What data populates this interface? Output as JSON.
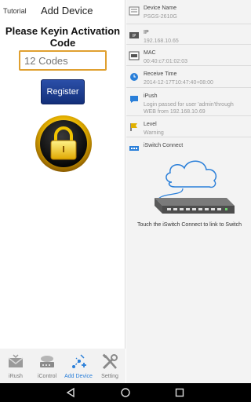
{
  "left": {
    "tutorial": "Tutorial",
    "title": "Add Device",
    "heading_line1": "Please Keyin Activation",
    "heading_line2": "Code",
    "codes_placeholder": "12 Codes",
    "register_label": "Register"
  },
  "nav": {
    "items": [
      {
        "label": "iRush",
        "icon": "mail-icon"
      },
      {
        "label": "iControl",
        "icon": "router-icon"
      },
      {
        "label": "Add Device",
        "icon": "add-device-icon"
      },
      {
        "label": "Setting",
        "icon": "tools-icon"
      }
    ],
    "active_index": 2
  },
  "right": {
    "rows": [
      {
        "label": "Device Name",
        "value": "PSGS-2610G",
        "icon": "device-icon"
      },
      {
        "label": "IP",
        "value": "192.168.10.65",
        "icon": "ip-icon"
      },
      {
        "label": "MAC",
        "value": "00:40:c7:01:02:03",
        "icon": "mac-icon"
      },
      {
        "label": "Receive Time",
        "value": "2014-12-17T10:47:40+08:00",
        "icon": "clock-icon"
      },
      {
        "label": "iPush",
        "value": "Login passed for user 'admin'through WEB from 192.168.10.69",
        "icon": "push-icon"
      },
      {
        "label": "Level",
        "value": "Warning",
        "icon": "flag-icon"
      },
      {
        "label": "iSwitch Connect",
        "value": "",
        "icon": "switch-icon"
      }
    ],
    "connect_caption": "Touch the iSwitch Connect to link to Switch"
  },
  "colors": {
    "accent_blue": "#2a7fd9",
    "register_blue": "#1f3f95",
    "input_border": "#e0a030",
    "lock_gold": "#f2c400"
  }
}
